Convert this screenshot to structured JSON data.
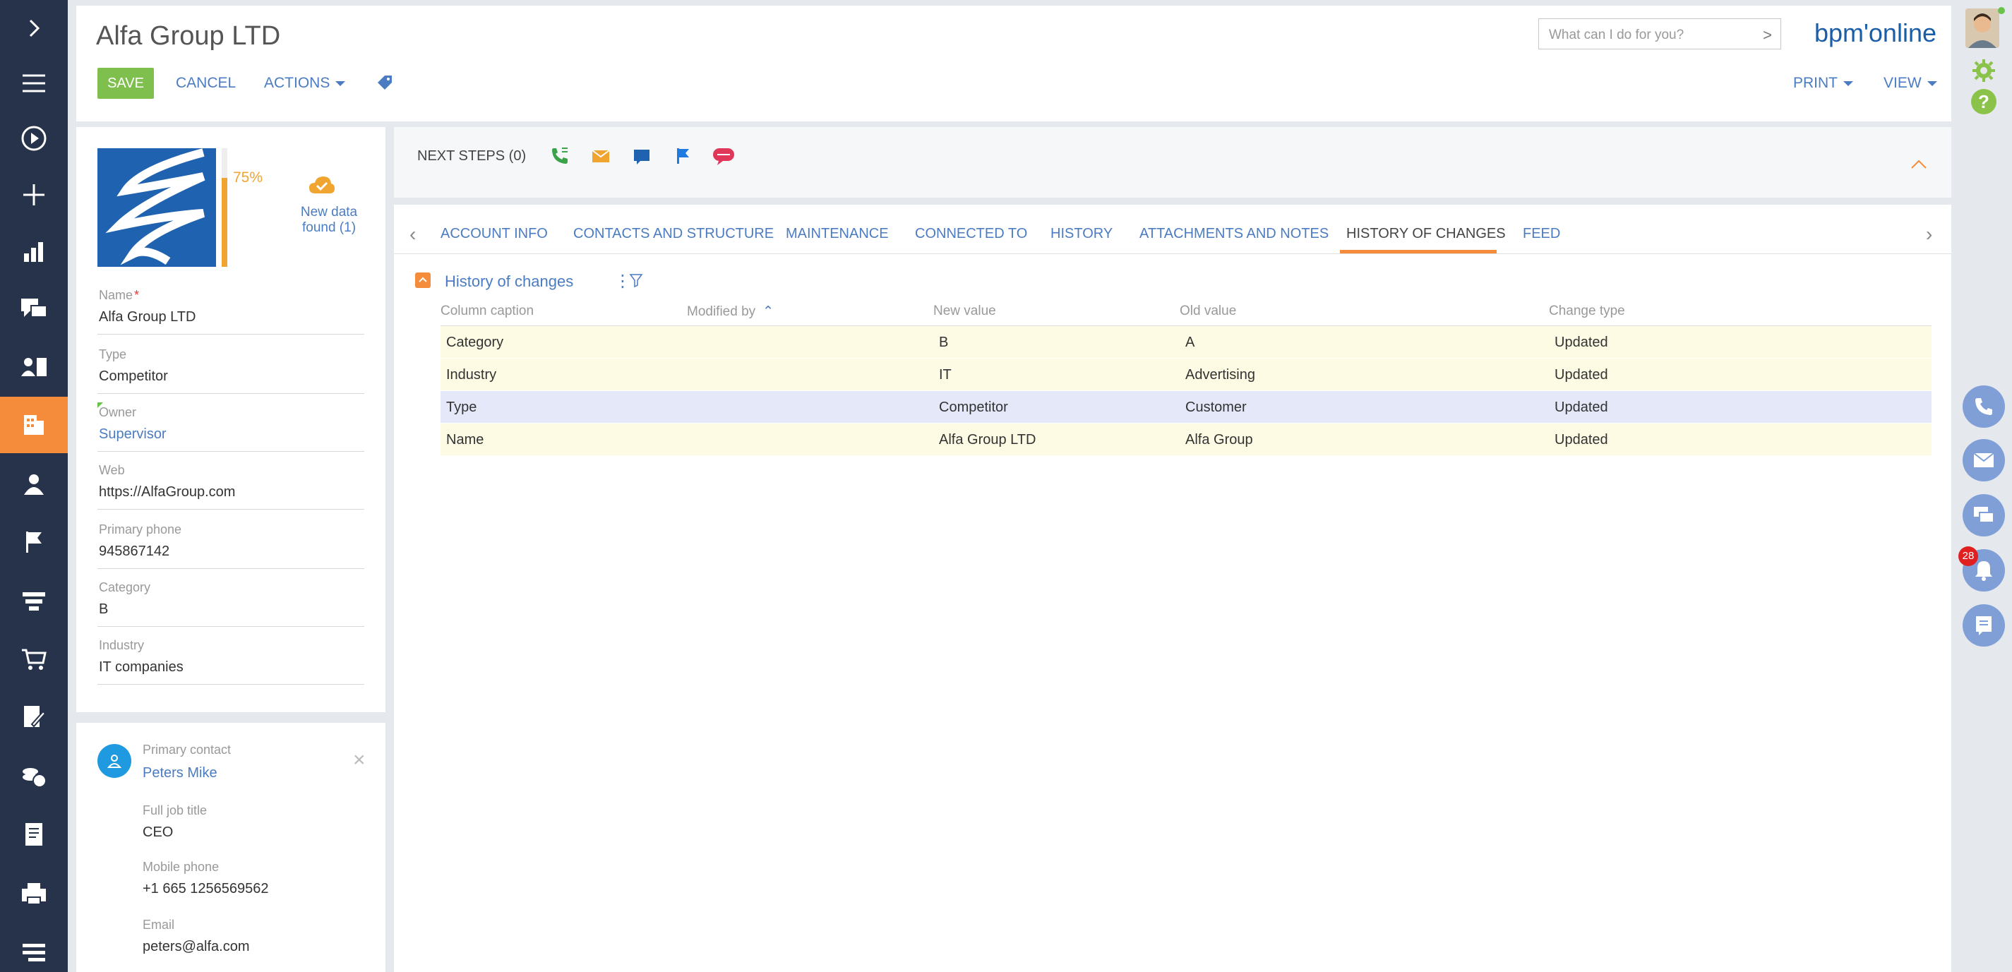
{
  "header": {
    "title": "Alfa Group LTD",
    "save_label": "SAVE",
    "cancel_label": "CANCEL",
    "actions_label": "ACTIONS",
    "print_label": "PRINT",
    "view_label": "VIEW",
    "search_placeholder": "What can I do for you?",
    "brand": "bpm'online"
  },
  "left_nav": {
    "items": [
      "expand-icon",
      "menu-icon",
      "play-icon",
      "add-icon",
      "dashboard-icon",
      "chat-icon",
      "contacts-book-icon",
      "accounts-icon",
      "person-icon",
      "flag-icon",
      "funnel-icon",
      "cart-icon",
      "edit-doc-icon",
      "coins-icon",
      "document-icon",
      "printer-icon",
      "stack-icon"
    ],
    "active": "accounts-icon"
  },
  "profile": {
    "completeness": "75%",
    "completeness_value": 0.75,
    "new_data": "New data found (1)",
    "fields": {
      "name_label": "Name",
      "name_value": "Alfa Group LTD",
      "type_label": "Type",
      "type_value": "Competitor",
      "owner_label": "Owner",
      "owner_value": "Supervisor",
      "web_label": "Web",
      "web_value": "https://AlfaGroup.com",
      "phone_label": "Primary phone",
      "phone_value": "945867142",
      "category_label": "Category",
      "category_value": "B",
      "industry_label": "Industry",
      "industry_value": "IT companies"
    }
  },
  "primary_contact": {
    "label": "Primary contact",
    "name": "Peters Mike",
    "job_label": "Full job title",
    "job_value": "CEO",
    "mobile_label": "Mobile phone",
    "mobile_value": "+1 665 1256569562",
    "email_label": "Email",
    "email_value": "peters@alfa.com"
  },
  "next_steps": {
    "label": "NEXT STEPS (0)"
  },
  "tabs": [
    {
      "label": "ACCOUNT INFO"
    },
    {
      "label": "CONTACTS AND STRUCTURE"
    },
    {
      "label": "MAINTENANCE"
    },
    {
      "label": "CONNECTED TO"
    },
    {
      "label": "HISTORY"
    },
    {
      "label": "ATTACHMENTS AND NOTES"
    },
    {
      "label": "HISTORY OF CHANGES"
    },
    {
      "label": "FEED"
    }
  ],
  "active_tab": "HISTORY OF CHANGES",
  "detail": {
    "title": "History of changes",
    "columns": [
      "Column caption",
      "Modified by",
      "New value",
      "Old value",
      "Change type"
    ],
    "rows": [
      {
        "caption": "Category",
        "modified_by": "",
        "new_value": "B",
        "old_value": "A",
        "change_type": "Updated"
      },
      {
        "caption": "Industry",
        "modified_by": "",
        "new_value": "IT",
        "old_value": "Advertising",
        "change_type": "Updated"
      },
      {
        "caption": "Type",
        "modified_by": "",
        "new_value": "Competitor",
        "old_value": "Customer",
        "change_type": "Updated"
      },
      {
        "caption": "Name",
        "modified_by": "",
        "new_value": "Alfa Group LTD",
        "old_value": "Alfa Group",
        "change_type": "Updated"
      }
    ]
  },
  "notifications": {
    "count": "28"
  },
  "colors": {
    "nav_bg": "#26334b",
    "accent": "#f58c3b",
    "link": "#4b7cc1",
    "save": "#7fbf4d",
    "row_highlight": "#fdfbe3",
    "row_selected": "#e4e8f8"
  }
}
